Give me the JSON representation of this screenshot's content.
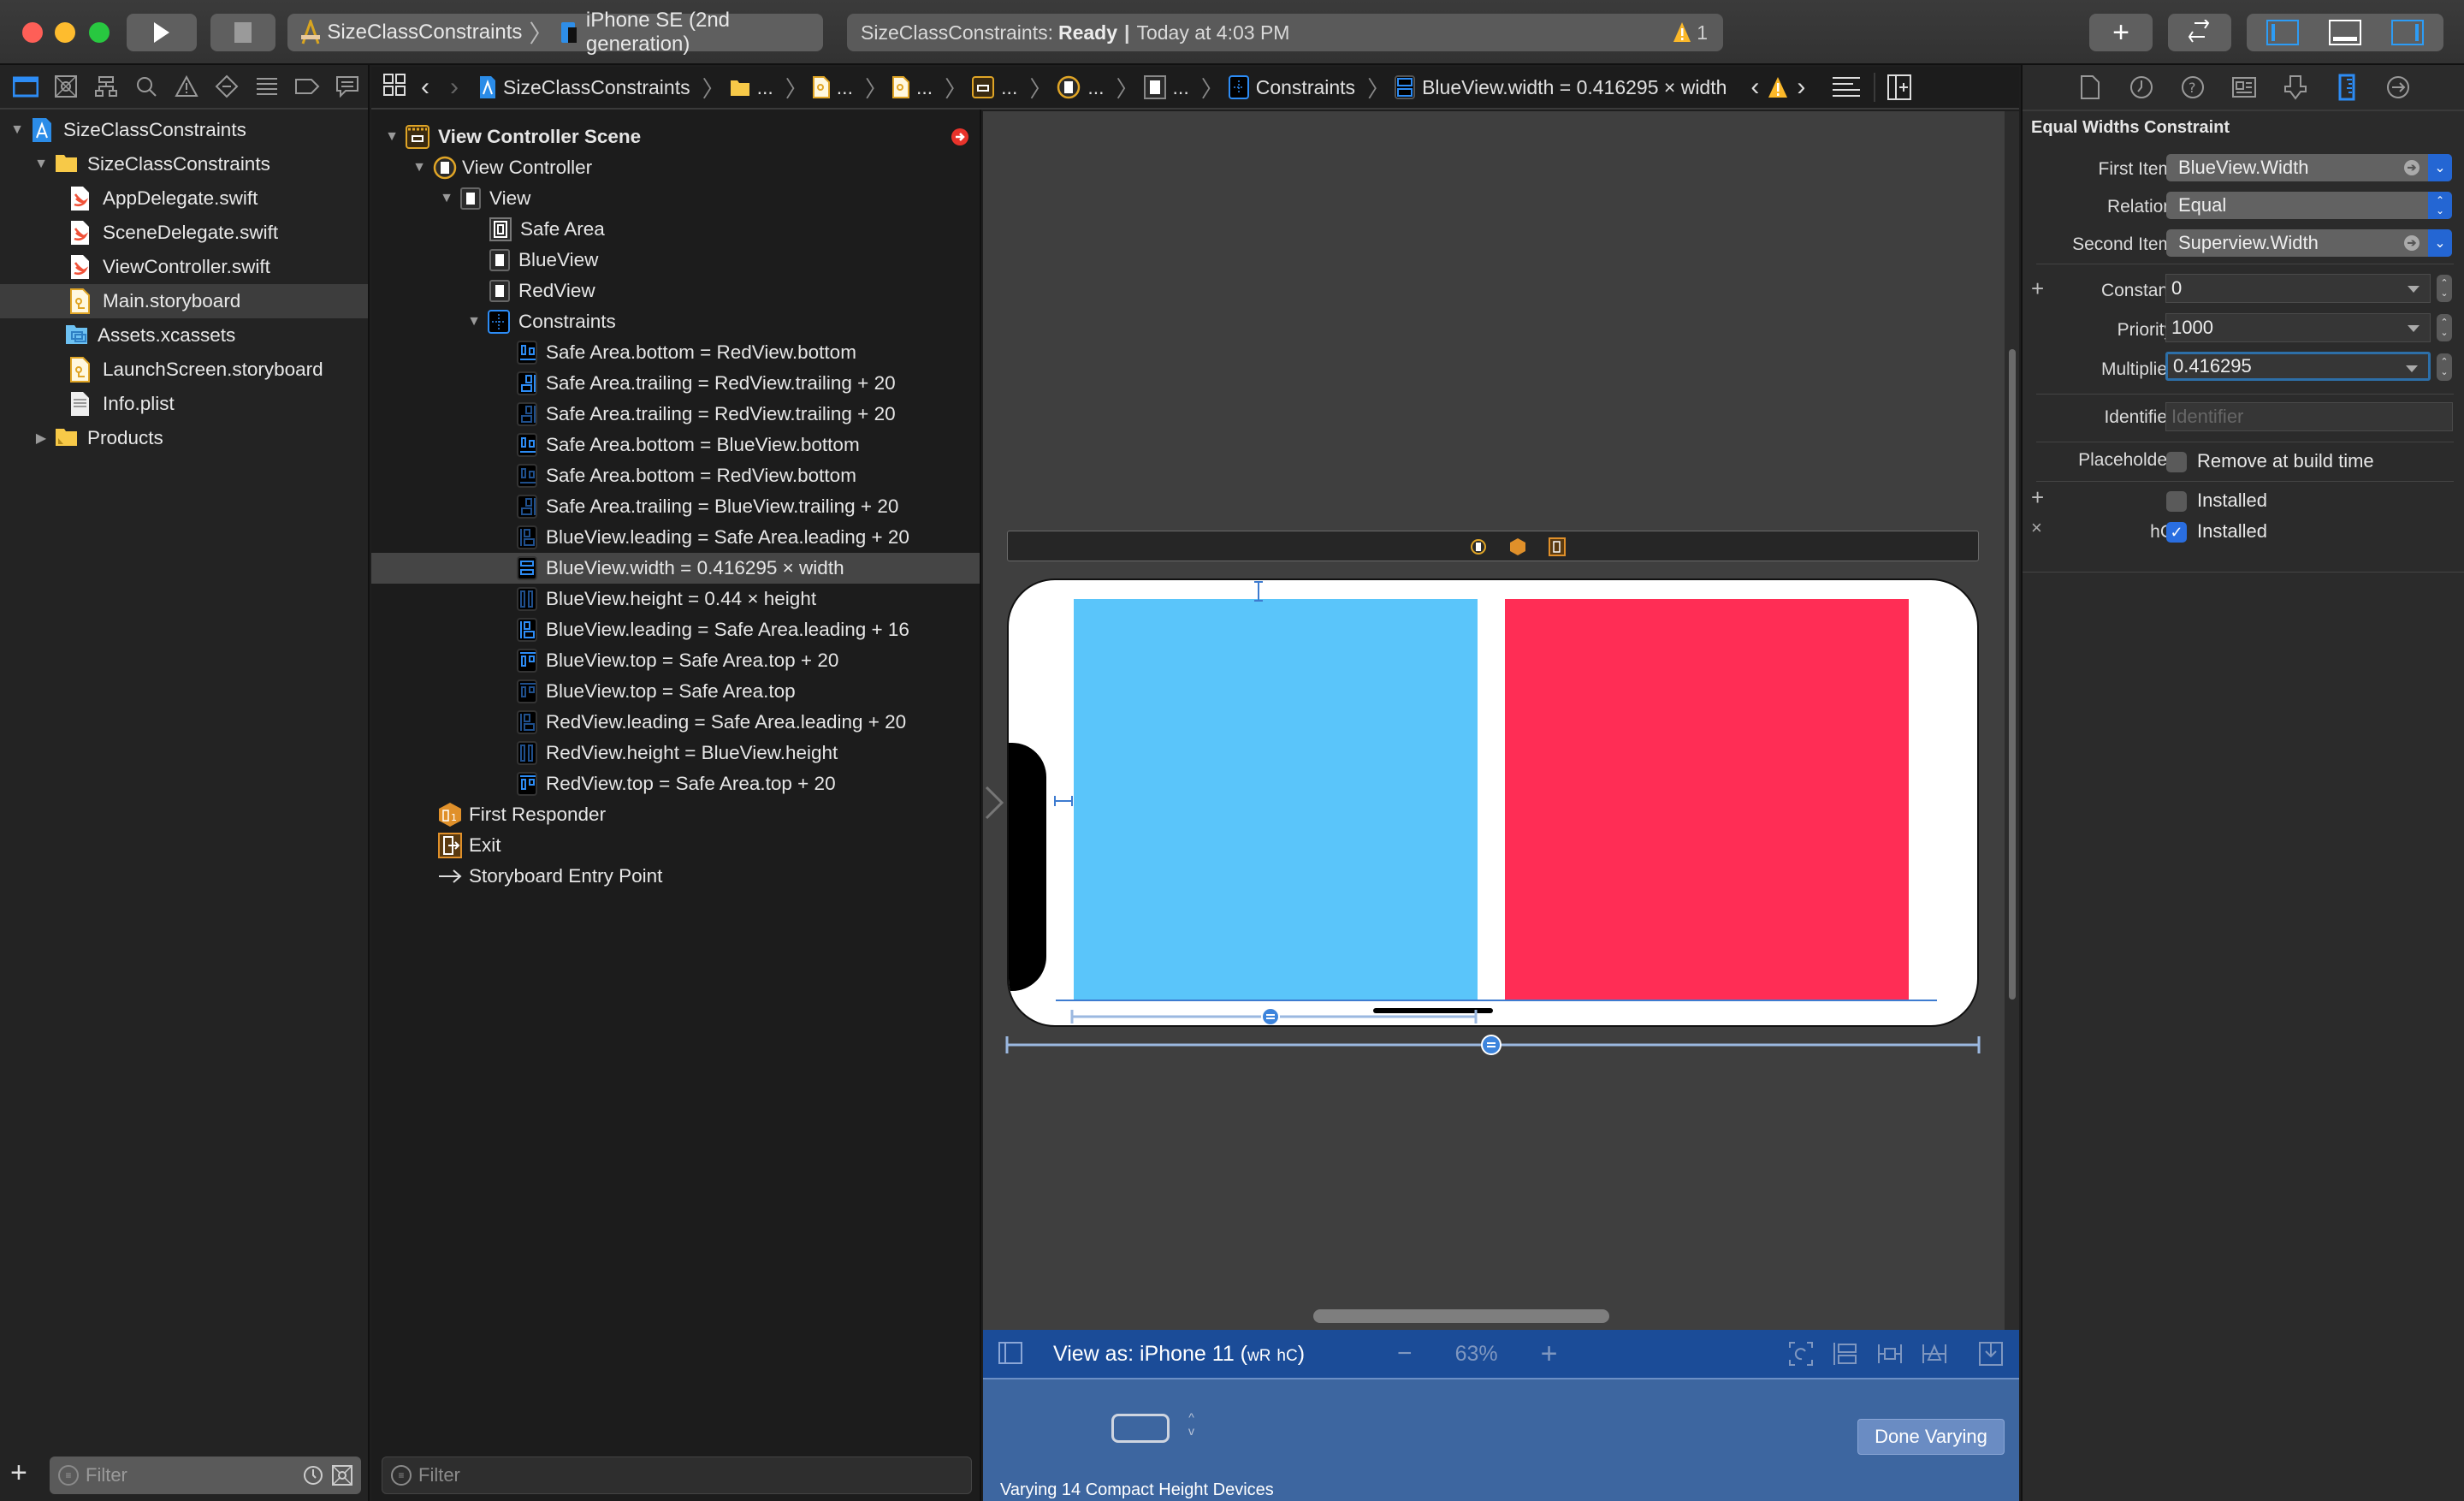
{
  "toolbar": {
    "scheme": "SizeClassConstraints",
    "destination": "iPhone SE (2nd generation)",
    "status_project": "SizeClassConstraints:",
    "status_state": "Ready",
    "status_separator": "|",
    "status_time": "Today at 4:03 PM",
    "warning_count": "1",
    "add_label": "+",
    "colors": {
      "close": "#fe5f57",
      "minimize": "#febc2e",
      "zoom": "#28c840",
      "accent": "#2d9cf5"
    }
  },
  "navigator": {
    "items": [
      {
        "label": "SizeClassConstraints",
        "type": "project",
        "expanded": true
      },
      {
        "label": "SizeClassConstraints",
        "type": "folder",
        "expanded": true
      },
      {
        "label": "AppDelegate.swift",
        "type": "swift"
      },
      {
        "label": "SceneDelegate.swift",
        "type": "swift"
      },
      {
        "label": "ViewController.swift",
        "type": "swift"
      },
      {
        "label": "Main.storyboard",
        "type": "storyboard",
        "selected": true
      },
      {
        "label": "Assets.xcassets",
        "type": "assets"
      },
      {
        "label": "LaunchScreen.storyboard",
        "type": "storyboard"
      },
      {
        "label": "Info.plist",
        "type": "plist"
      },
      {
        "label": "Products",
        "type": "folder",
        "expanded": false
      }
    ],
    "filter_placeholder": "Filter"
  },
  "jumpbar": {
    "project": "SizeClassConstraints",
    "ellipsis": "...",
    "constraints": "Constraints",
    "current": "BlueView.width = 0.416295 × width"
  },
  "outline": {
    "scene": "View Controller Scene",
    "view_controller": "View Controller",
    "view": "View",
    "subviews": [
      "Safe Area",
      "BlueView",
      "RedView"
    ],
    "constraints_label": "Constraints",
    "constraints": [
      {
        "label": "Safe Area.bottom = RedView.bottom",
        "kind": "bottom",
        "active": true
      },
      {
        "label": "Safe Area.trailing = RedView.trailing + 20",
        "kind": "trailing",
        "active": true
      },
      {
        "label": "Safe Area.trailing = RedView.trailing + 20",
        "kind": "trailing",
        "active": false
      },
      {
        "label": "Safe Area.bottom = BlueView.bottom",
        "kind": "bottom",
        "active": true
      },
      {
        "label": "Safe Area.bottom = RedView.bottom",
        "kind": "bottom",
        "active": false
      },
      {
        "label": "Safe Area.trailing = BlueView.trailing + 20",
        "kind": "trailing",
        "active": false
      },
      {
        "label": "BlueView.leading = Safe Area.leading + 20",
        "kind": "leading",
        "active": false
      },
      {
        "label": "BlueView.width = 0.416295 × width",
        "kind": "width",
        "active": true,
        "selected": true
      },
      {
        "label": "BlueView.height = 0.44 × height",
        "kind": "height",
        "active": false
      },
      {
        "label": "BlueView.leading = Safe Area.leading + 16",
        "kind": "leading",
        "active": true
      },
      {
        "label": "BlueView.top = Safe Area.top + 20",
        "kind": "top",
        "active": true
      },
      {
        "label": "BlueView.top = Safe Area.top",
        "kind": "top",
        "active": false
      },
      {
        "label": "RedView.leading = Safe Area.leading + 20",
        "kind": "leading",
        "active": false
      },
      {
        "label": "RedView.height = BlueView.height",
        "kind": "height",
        "active": false
      },
      {
        "label": "RedView.top = Safe Area.top + 20",
        "kind": "top",
        "active": true
      }
    ],
    "first_responder": "First Responder",
    "exit": "Exit",
    "entry_point": "Storyboard Entry Point",
    "filter_placeholder": "Filter"
  },
  "canvas": {
    "blue_color": "#5ac5fa",
    "red_color": "#ff2d55"
  },
  "device_bar": {
    "view_as": "View as: iPhone 11 (",
    "w_class": "wR",
    "h_class": "hC",
    "close_paren": ")",
    "zoom_minus": "−",
    "zoom_level": "63%",
    "zoom_plus": "+",
    "varying_text": "Varying 14 Compact Height Devices",
    "done_button": "Done Varying"
  },
  "inspector": {
    "title": "Equal Widths Constraint",
    "first_item_label": "First Item",
    "first_item": "BlueView.Width",
    "relation_label": "Relation",
    "relation": "Equal",
    "second_item_label": "Second Item",
    "second_item": "Superview.Width",
    "constant_label": "Constant",
    "constant": "0",
    "priority_label": "Priority",
    "priority": "1000",
    "multiplier_label": "Multiplier",
    "multiplier": "0.416295",
    "identifier_label": "Identifier",
    "identifier_placeholder": "Identifier",
    "placeholder_label": "Placeholder",
    "remove_at_build": "Remove at build time",
    "remove_at_build_checked": false,
    "installed_label": "Installed",
    "installed_default_checked": false,
    "variation_label": "hC",
    "installed_variation_checked": true
  }
}
